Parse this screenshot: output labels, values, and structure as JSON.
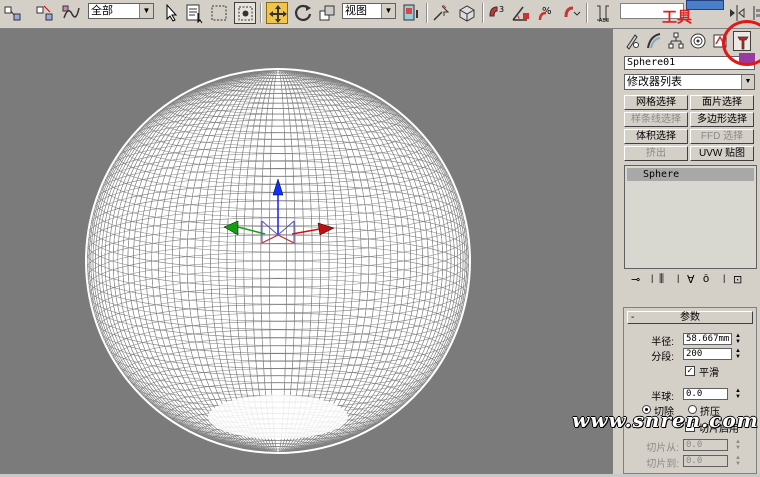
{
  "toolbar": {
    "selection_filter": "全部",
    "reference_coord": "视图"
  },
  "panel": {
    "object_name": "Sphere01",
    "modifier_list": "修改器列表",
    "modifier_buttons": [
      {
        "label": "网格选择",
        "enabled": true
      },
      {
        "label": "面片选择",
        "enabled": true
      },
      {
        "label": "样条线选择",
        "enabled": false
      },
      {
        "label": "多边形选择",
        "enabled": true
      },
      {
        "label": "体积选择",
        "enabled": true
      },
      {
        "label": "FFD 选择",
        "enabled": false
      },
      {
        "label": "挤出",
        "enabled": false
      },
      {
        "label": "UVW 贴图",
        "enabled": true
      }
    ],
    "stack_item": "Sphere",
    "rollout": {
      "minus": "-",
      "title": "参数",
      "radius_label": "半径:",
      "radius_value": "58.667mm",
      "segments_label": "分段:",
      "segments_value": "200",
      "smooth_label": "平滑",
      "hemisphere_label": "半球:",
      "hemisphere_value": "0.0",
      "chop_label": "切除",
      "squash_label": "挤压",
      "slice_on_label": "切片启用",
      "slice_from_label": "切片从:",
      "slice_from_value": "0.0",
      "slice_to_label": "切片到:",
      "slice_to_value": "0.0"
    }
  },
  "annotation": {
    "tools_label": "工具"
  },
  "watermark": "www.snren.com",
  "colors": {
    "viewport_bg": "#7b7b7b",
    "active_tool": "#f3c44a",
    "annotation_red": "#e02020"
  }
}
